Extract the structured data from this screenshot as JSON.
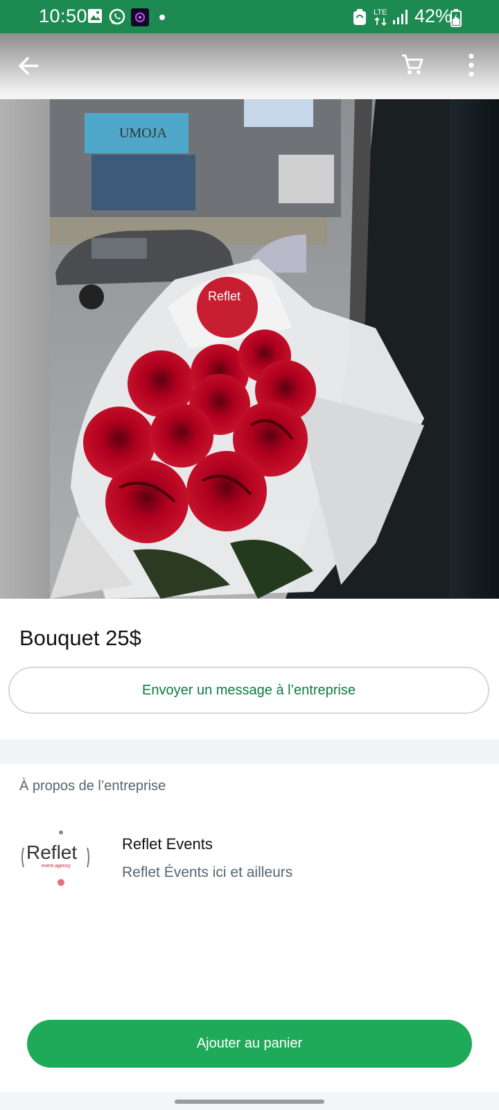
{
  "status_bar": {
    "time": "10:50",
    "network": "LTE",
    "battery": "42%",
    "icons": [
      "gallery-icon",
      "whatsapp-icon",
      "app-icon",
      "dot-icon",
      "battery-saver-icon",
      "lte-icon",
      "signal-icon",
      "battery-icon"
    ]
  },
  "app_bar": {
    "back_icon": "arrow-left-icon",
    "cart_icon": "cart-icon",
    "menu_icon": "more-vert-icon"
  },
  "product": {
    "image": "red-roses-bouquet",
    "image_sticker_text": "Reflet",
    "title": "Bouquet 25$",
    "message_button": "Envoyer un message à l’entreprise"
  },
  "about": {
    "label": "À propos de l’entreprise",
    "logo_text": "Reflet",
    "logo_sub": "event agency",
    "business_name": "Reflet Events",
    "business_description": "Reflet Évents ici et ailleurs"
  },
  "actions": {
    "add_to_cart": "Ajouter au panier"
  },
  "colors": {
    "status_bar": "#1d8a52",
    "accent_text": "#0b7a44",
    "primary_button": "#1faa59"
  }
}
